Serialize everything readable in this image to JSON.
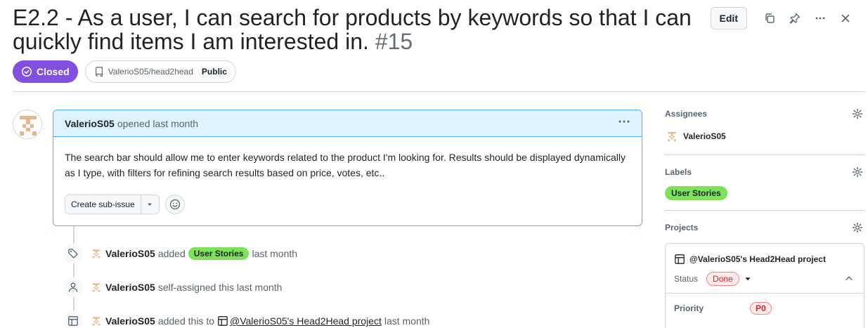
{
  "issue": {
    "title": "E2.2 - As a user, I can search for products by keywords so that I can quickly find items I am interested in.",
    "number": "#15",
    "state": "Closed",
    "repo": "ValerioS05/head2head",
    "visibility": "Public"
  },
  "header_actions": {
    "edit_label": "Edit",
    "icons": [
      "copy-icon",
      "pin-icon",
      "kebab-icon",
      "close-icon"
    ]
  },
  "comment": {
    "author": "ValerioS05",
    "meta": "opened last month",
    "body": "The search bar should allow me to enter keywords related to the product I'm looking for. Results should be displayed dynamically as I type, with filters for refining search results based on price, votes, etc..",
    "create_subissue_label": "Create sub-issue"
  },
  "timeline": [
    {
      "icon": "tag-icon",
      "actor": "ValerioS05",
      "pre": "added",
      "label": "User Stories",
      "post": "last month"
    },
    {
      "icon": "person-icon",
      "actor": "ValerioS05",
      "text": "self-assigned this last month"
    },
    {
      "icon": "table-icon",
      "actor": "ValerioS05",
      "pre": "added this to",
      "link": "@ValerioS05's Head2Head project",
      "post": "last month"
    }
  ],
  "sidebar": {
    "assignees": {
      "heading": "Assignees",
      "user": "ValerioS05"
    },
    "labels": {
      "heading": "Labels",
      "label": "User Stories"
    },
    "projects": {
      "heading": "Projects",
      "project_name": "@ValerioS05's Head2Head project",
      "status_label": "Status",
      "status_value": "Done",
      "priority_label": "Priority",
      "priority_value": "P0"
    }
  },
  "colors": {
    "closed": "#8250df",
    "label_green": "#7ee15a",
    "comment_header": "#ddf4ff",
    "comment_border": "#54aeff",
    "done_red": "#d1242f"
  }
}
